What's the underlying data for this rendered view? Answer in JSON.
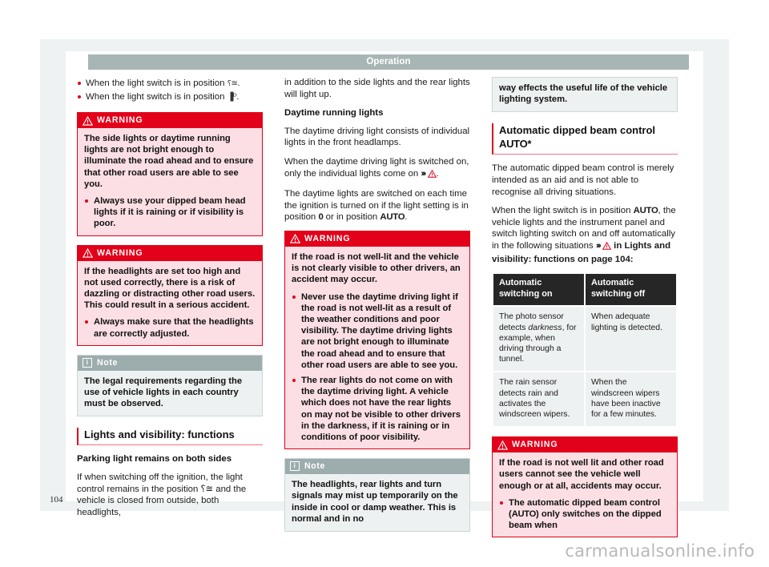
{
  "document": {
    "chapter_title": "Operation",
    "page_number": "104",
    "watermark": "carmanualsonline.info"
  },
  "labels": {
    "warning": "WARNING",
    "note": "Note",
    "warning_icon": "warning-triangle-icon",
    "note_icon": "info-icon"
  },
  "column1": {
    "bullets": [
      {
        "text_before": "When the light switch is in position",
        "symbol": "⸮≊",
        "text_after": "."
      },
      {
        "text_before": "When the light switch is in position",
        "symbol": "▐ᴰ",
        "text_after": "."
      }
    ],
    "warning1": {
      "paragraph": "The side lights or daytime running lights are not bright enough to illuminate the road ahead and to ensure that other road users are able to see you.",
      "bullets": [
        "Always use your dipped beam head lights if it is raining or if visibility is poor."
      ]
    },
    "warning2": {
      "paragraph": "If the headlights are set too high and not used correctly, there is a risk of dazzling or distracting other road users. This could result in a serious accident.",
      "bullets": [
        "Always make sure that the headlights are correctly adjusted."
      ]
    },
    "note1": {
      "paragraph": "The legal requirements regarding the use of vehicle lights in each country must be observed."
    },
    "section_heading": "Lights and visibility: functions",
    "subheading": "Parking light remains on both sides",
    "paragraph": "If when switching off the ignition, the light control remains in the position ⸮≊ and the vehicle is closed from outside, both headlights,"
  },
  "column2": {
    "paragraph_continued": "in addition to the side lights and the rear lights will light up.",
    "subheading": "Daytime running lights",
    "paragraph1": "The daytime driving light consists of individual lights in the front headlamps.",
    "paragraph2_a": "When the daytime driving light is switched on, only the individual lights come on",
    "paragraph2_b": ".",
    "paragraph3_a": "The daytime lights are switched on each time the ignition is turned on if the light setting is in position",
    "paragraph3_pos1": "0",
    "paragraph3_mid": "or in position",
    "paragraph3_pos2": "AUTO",
    "paragraph3_end": ".",
    "warning1": {
      "paragraph": "If the road is not well-lit and the vehicle is not clearly visible to other drivers, an accident may occur.",
      "bullets": [
        "Never use the daytime driving light if the road is not well-lit as a result of the weather conditions and poor visibility. The daytime driving lights are not bright enough to illuminate the road ahead and to ensure that other road users are able to see you.",
        "The rear lights do not come on with the daytime driving light. A vehicle which does not have the rear lights on may not be visible to other drivers in the darkness, if it is raining or in conditions of poor visibility."
      ]
    },
    "note1": {
      "paragraph": "The headlights, rear lights and turn signals may mist up temporarily on the inside in cool or damp weather. This is normal and in no"
    }
  },
  "column3": {
    "note_continued": {
      "paragraph": "way effects the useful life of the vehicle lighting system."
    },
    "section_heading_a": "Automatic dipped beam control",
    "section_heading_b": "AUTO*",
    "paragraph1": "The automatic dipped beam control is merely intended as an aid and is not able to recognise all driving situations.",
    "paragraph2_a": "When the light switch is in position",
    "paragraph2_pos": "AUTO",
    "paragraph2_b": ", the vehicle lights and the instrument panel and switch lighting switch on and off automatically in the following situations",
    "paragraph2_c": "in Lights and visibility: functions on page 104:",
    "table": {
      "headers": [
        "Automatic switching on",
        "Automatic switching off"
      ],
      "rows": [
        {
          "on_pre": "The photo sensor detects",
          "on_italic": "darkness",
          "on_post": ", for example, when driving through a tunnel.",
          "off": "When adequate lighting is detected."
        },
        {
          "on_pre": "The rain sensor detects rain and activates the windscreen wipers.",
          "on_italic": "",
          "on_post": "",
          "off": "When the windscreen wipers have been inactive for a few minutes."
        }
      ]
    },
    "warning1": {
      "paragraph": "If the road is not well lit and other road users cannot see the vehicle well enough or at all, accidents may occur.",
      "bullets_a": "The automatic dipped beam control (",
      "bullets_pos": "AUTO",
      "bullets_b": ") only switches on the dipped beam when"
    }
  },
  "colors": {
    "warning_red": "#e2001a",
    "warning_bg": "#fbdfe4",
    "note_head": "#9dadad",
    "note_bg": "#eef1f1",
    "chapter_bar": "#a7b5b5",
    "table_header": "#262626"
  }
}
